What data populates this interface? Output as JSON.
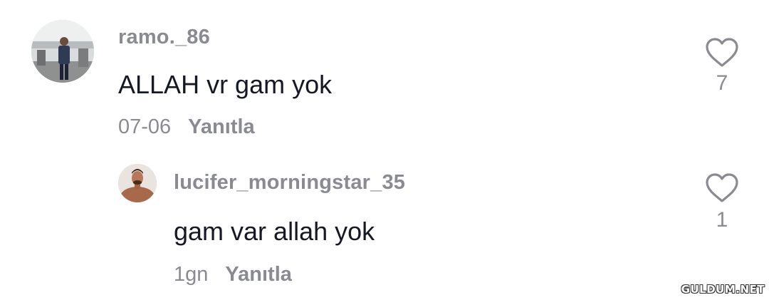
{
  "comments": [
    {
      "username": "ramo._86",
      "text": "ALLAH vr gam yok",
      "date": "07-06",
      "reply_label": "Yanıtla",
      "like_count": "7",
      "like_icon": "heart-outline-icon"
    },
    {
      "username": "lucifer_morningstar_35",
      "text": "gam var allah yok",
      "date": "1gn",
      "reply_label": "Yanıtla",
      "like_count": "1",
      "like_icon": "heart-outline-icon"
    }
  ],
  "watermark": "GULDUM.NET",
  "colors": {
    "primary_text": "#161823",
    "secondary_text": "#8a8b91",
    "background": "#ffffff"
  }
}
